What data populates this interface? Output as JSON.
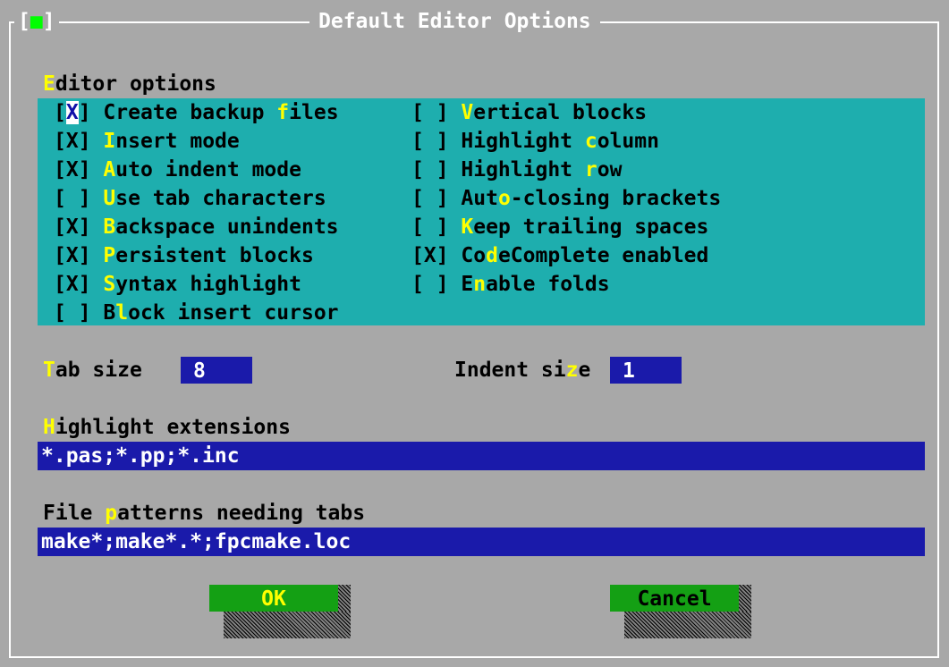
{
  "window": {
    "close_open": "[",
    "close_glyph": "■",
    "close_close": "]",
    "title": "Default Editor Options"
  },
  "editor_options": {
    "heading_hot": "E",
    "heading_rest": "ditor options",
    "left": [
      {
        "box": "[X]",
        "pre": " Create backup ",
        "hot": "f",
        "post": "iles",
        "checked": true
      },
      {
        "box": "[X]",
        "pre": " ",
        "hot": "I",
        "post": "nsert mode",
        "checked": true
      },
      {
        "box": "[X]",
        "pre": " ",
        "hot": "A",
        "post": "uto indent mode",
        "checked": true
      },
      {
        "box": "[ ]",
        "pre": " ",
        "hot": "U",
        "post": "se tab characters",
        "checked": false
      },
      {
        "box": "[X]",
        "pre": " ",
        "hot": "B",
        "post": "ackspace unindents",
        "checked": true
      },
      {
        "box": "[X]",
        "pre": " ",
        "hot": "P",
        "post": "ersistent blocks",
        "checked": true
      },
      {
        "box": "[X]",
        "pre": " ",
        "hot": "S",
        "post": "yntax highlight",
        "checked": true
      },
      {
        "box": "[ ]",
        "pre": " B",
        "hot": "l",
        "post": "ock insert cursor",
        "checked": false
      }
    ],
    "right": [
      {
        "box": "[ ]",
        "pre": " ",
        "hot": "V",
        "post": "ertical blocks",
        "checked": false
      },
      {
        "box": "[ ]",
        "pre": " Highlight ",
        "hot": "c",
        "post": "olumn",
        "checked": false
      },
      {
        "box": "[ ]",
        "pre": " Highlight ",
        "hot": "r",
        "post": "ow",
        "checked": false
      },
      {
        "box": "[ ]",
        "pre": " Aut",
        "hot": "o",
        "post": "-closing brackets",
        "checked": false
      },
      {
        "box": "[ ]",
        "pre": " ",
        "hot": "K",
        "post": "eep trailing spaces",
        "checked": false
      },
      {
        "box": "[X]",
        "pre": " Co",
        "hot": "d",
        "post": "eComplete enabled",
        "checked": true
      },
      {
        "box": "[ ]",
        "pre": " E",
        "hot": "n",
        "post": "able folds",
        "checked": false
      }
    ]
  },
  "tab_size": {
    "label_hot": "T",
    "label_rest": "ab size ",
    "value": "8"
  },
  "indent_size": {
    "label_pre": "Indent si",
    "label_hot": "z",
    "label_post": "e",
    "value": "1"
  },
  "highlight_extensions": {
    "label_hot": "H",
    "label_rest": "ighlight extensions",
    "value": "*.pas;*.pp;*.inc"
  },
  "file_patterns": {
    "label_pre": "File ",
    "label_hot": "p",
    "label_post": "atterns needing tabs",
    "value": "make*;make*.*;fpcmake.loc"
  },
  "buttons": {
    "ok": "OK",
    "cancel": "Cancel"
  },
  "colors": {
    "dialog_bg": "#a8a8a8",
    "cluster_bg": "#1eaeae",
    "input_bg": "#1a1aaa",
    "button_bg": "#14a014",
    "hotkey": "#ffff00"
  }
}
